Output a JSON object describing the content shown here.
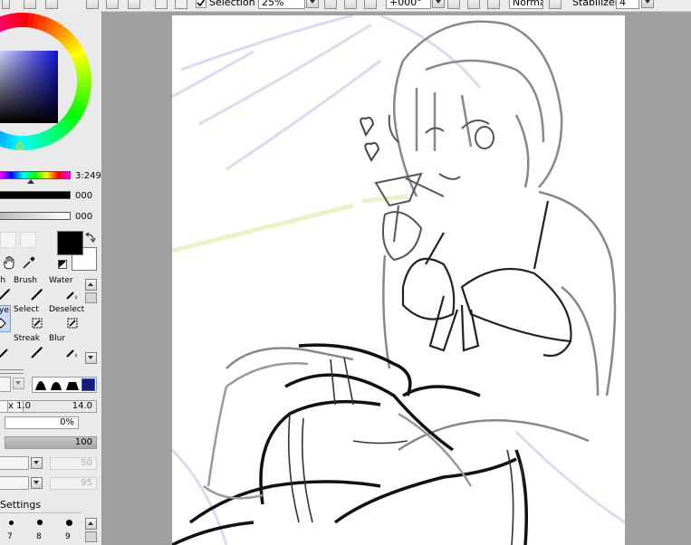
{
  "toolbar": {
    "selection_label": "Selection",
    "zoom_value": "25%",
    "rotation_value": "+000°",
    "blend_mode": "Normal",
    "stabilizer_label": "Stabilizer",
    "stabilizer_value": "4"
  },
  "color_panel": {
    "hue_value": "3:249",
    "slider_1_value": "000",
    "slider_2_value": "000",
    "primary_color": "#000000",
    "secondary_color": "#ffffff",
    "hue_ring_icon": "color-wheel",
    "square_color": "#1a1a9a"
  },
  "tools": [
    {
      "label": "ush"
    },
    {
      "label": "Brush"
    },
    {
      "label": "Water"
    },
    {
      "label": "ye"
    },
    {
      "label": "Select"
    },
    {
      "label": "Deselect"
    },
    {
      "label": ""
    },
    {
      "label": "Streak"
    },
    {
      "label": "Blur"
    }
  ],
  "brush_settings": {
    "size_multiplier": "x 1.0",
    "size_value": "14.0",
    "min_size_value": "0%",
    "density_value": "100",
    "field_1_value": "50",
    "field_2_value": "95",
    "settings_label": "Settings",
    "size_presets": [
      "7",
      "8",
      "9"
    ]
  }
}
